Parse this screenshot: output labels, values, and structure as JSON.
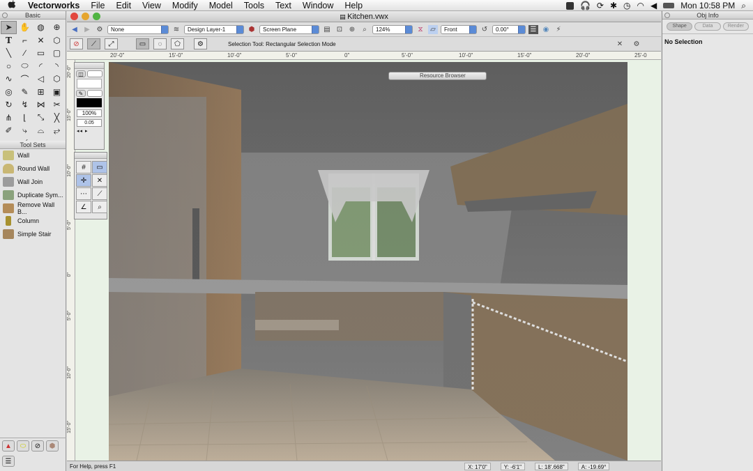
{
  "menubar": {
    "apple": "",
    "app": "Vectorworks",
    "items": [
      "File",
      "Edit",
      "View",
      "Modify",
      "Model",
      "Tools",
      "Text",
      "Window",
      "Help"
    ],
    "clock": "Mon 10:58 PM"
  },
  "palettes": {
    "basic_title": "Basic",
    "toolsets_title": "Tool Sets",
    "toolset_items": [
      "Wall",
      "Round Wall",
      "Wall Join",
      "Duplicate Sym...",
      "Remove Wall B...",
      "Column",
      "Simple Stair"
    ],
    "opacity": "100%",
    "line_weight": "0.05"
  },
  "document": {
    "title": "Kitchen.vwx"
  },
  "toolbar": {
    "class": "None",
    "layer": "Design Layer-1",
    "plane": "Screen Plane",
    "zoom": "124%",
    "view": "Front",
    "angle": "0.00°",
    "status": "Selection Tool: Rectangular Selection Mode"
  },
  "ruler": {
    "h_ticks": [
      "20'-0\"",
      "15'-0\"",
      "10'-0\"",
      "5'-0\"",
      "0\"",
      "5'-0\"",
      "10'-0\"",
      "15'-0\"",
      "20'-0\"",
      "25'-0"
    ],
    "v_ticks": [
      "20'-0\"",
      "15'-0\"",
      "10'-0\"",
      "5'-0\"",
      "0\"",
      "5'-0\"",
      "10'-0\"",
      "15'-0\""
    ]
  },
  "resource_browser": {
    "title": "Resource Browser"
  },
  "statusbar": {
    "help": "For Help, press F1",
    "x": "X: 17'0\"",
    "y": "Y: -6'1\"",
    "l": "L: 18'.668\"",
    "a": "A: -19.69°"
  },
  "objinfo": {
    "title": "Obj Info",
    "tabs": [
      "Shape",
      "Data",
      "Render"
    ],
    "selection": "No Selection"
  }
}
